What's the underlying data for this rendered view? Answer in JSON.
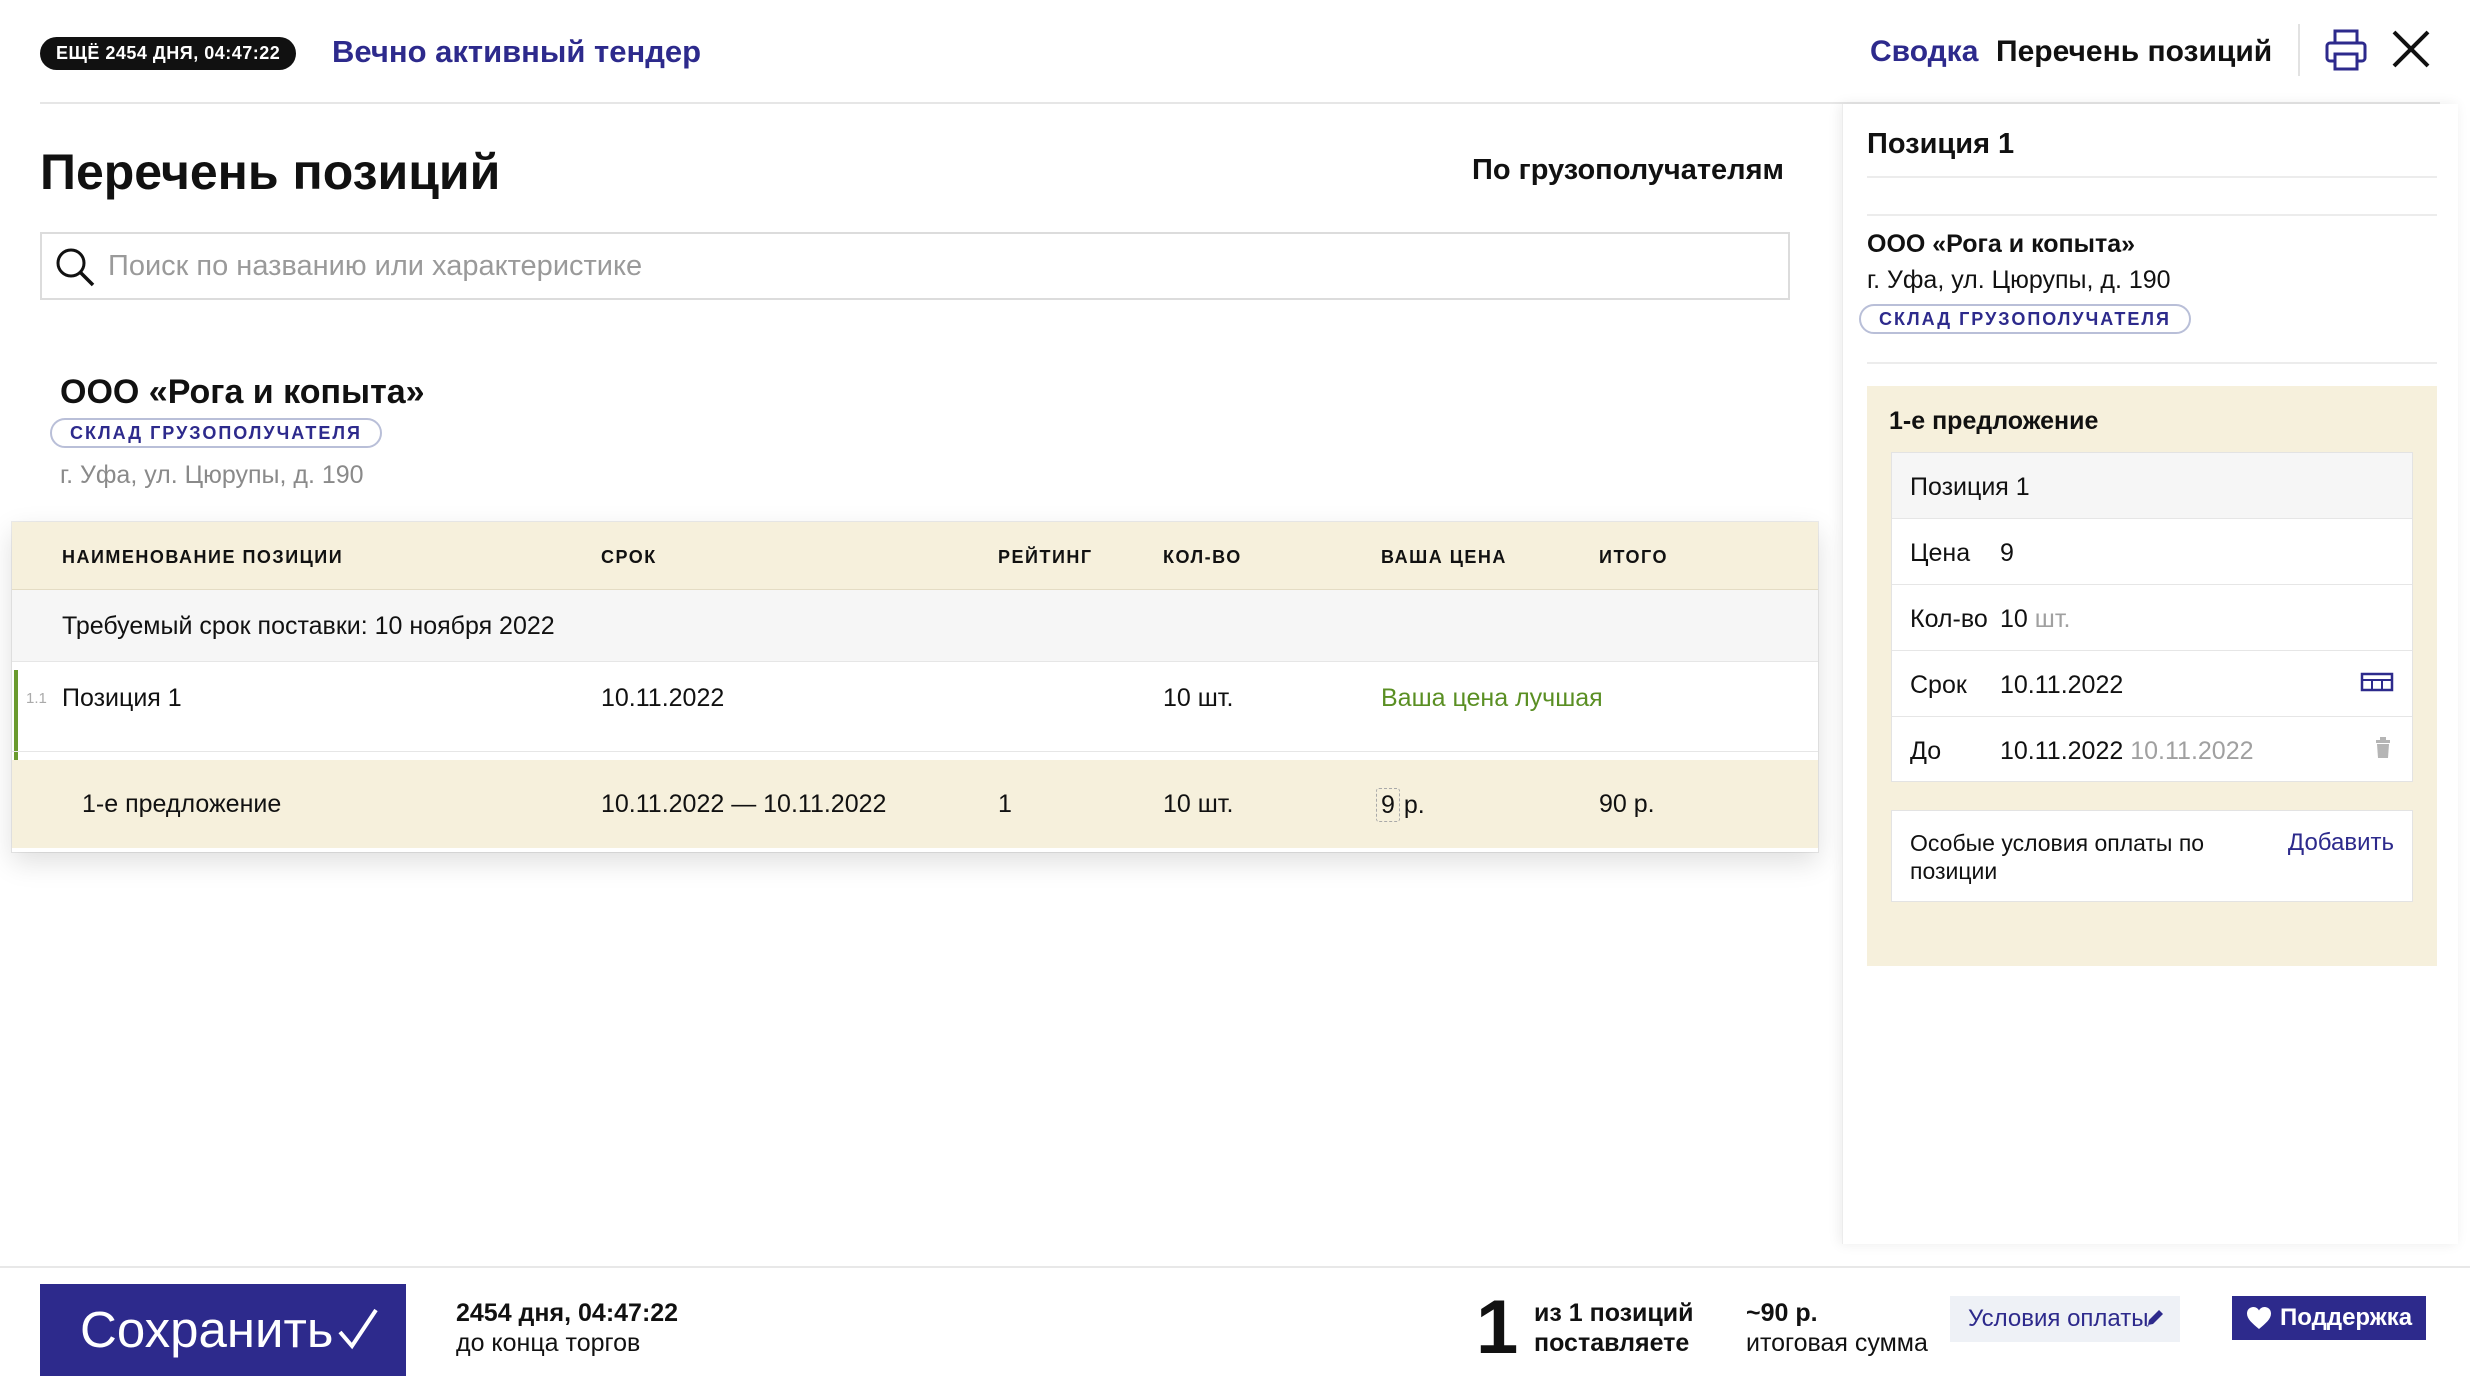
{
  "header": {
    "timer_badge": "ЕЩЁ 2454 ДНЯ, 04:47:22",
    "tender_title": "Вечно активный тендер",
    "nav_summary": "Сводка",
    "nav_positions": "Перечень позиций"
  },
  "main": {
    "page_title": "Перечень позиций",
    "group_toggle": "По грузополучателям",
    "search_placeholder": "Поиск по названию или характеристике",
    "consignee": {
      "name": "ООО «Рога и копыта»",
      "tag": "СКЛАД ГРУЗОПОЛУЧАТЕЛЯ",
      "address": "г. Уфа, ул. Цюрупы, д. 190"
    },
    "table": {
      "columns": [
        "НАИМЕНОВАНИЕ ПОЗИЦИИ",
        "СРОК",
        "РЕЙТИНГ",
        "КОЛ-ВО",
        "ВАША ЦЕНА",
        "ИТОГО"
      ],
      "section_label": "Требуемый срок поставки: 10 ноября 2022",
      "position_row": {
        "num": "1.1",
        "name": "Позиция 1",
        "date": "10.11.2022",
        "rating": "",
        "qty": "10 шт.",
        "price_note": "Ваша цена лучшая",
        "total": ""
      },
      "offer_row": {
        "name": "1-е предложение",
        "date": "10.11.2022 — 10.11.2022",
        "rating": "1",
        "qty": "10 шт.",
        "price_value": "9",
        "price_unit": "р.",
        "total": "90 р."
      }
    }
  },
  "side_panel": {
    "title": "Позиция 1",
    "consignee_name": "ООО «Рога и копыта»",
    "consignee_address": "г. Уфа, ул. Цюрупы, д. 190",
    "consignee_tag": "СКЛАД ГРУЗОПОЛУЧАТЕЛЯ",
    "offer": {
      "title": "1-е предложение",
      "position_name": "Позиция 1",
      "price_label": "Цена",
      "price_value": "9",
      "qty_label": "Кол-во",
      "qty_value": "10",
      "qty_unit": "шт.",
      "term_label": "Срок",
      "term_value": "10.11.2022",
      "until_label": "До",
      "until_value": "10.11.2022",
      "until_hint": "10.11.2022",
      "payment_label": "Особые условия оплаты по позиции",
      "payment_add": "Добавить"
    }
  },
  "footer": {
    "save_label": "Сохранить",
    "deadline_value": "2454 дня, 04:47:22",
    "deadline_caption": "до конца торгов",
    "count_big": "1",
    "count_value": "из 1 позиций",
    "count_caption": "поставляете",
    "sum_value": "~90 р.",
    "sum_caption": "итоговая сумма",
    "payment_terms_label": "Условия оплаты",
    "support_label": "Поддержка"
  },
  "colors": {
    "accent": "#2d2a8c",
    "highlight": "#f6f0dc",
    "success": "#5a8f23"
  }
}
